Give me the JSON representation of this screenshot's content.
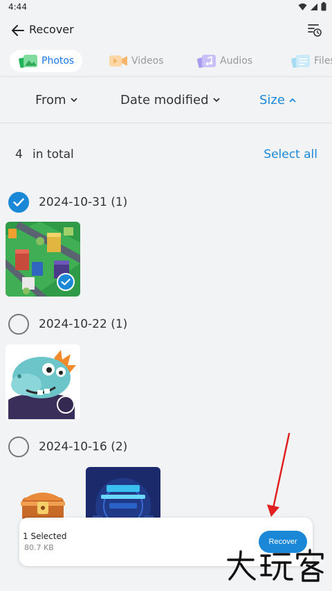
{
  "status_bar": {
    "time": "4:44"
  },
  "header": {
    "title": "Recover"
  },
  "tabs": [
    {
      "label": "Photos",
      "icon": "photo-icon",
      "active": true
    },
    {
      "label": "Videos",
      "icon": "video-icon",
      "active": false
    },
    {
      "label": "Audios",
      "icon": "audio-icon",
      "active": false
    },
    {
      "label": "Files",
      "icon": "file-icon",
      "active": false
    }
  ],
  "sort": {
    "from": "From",
    "date_modified": "Date modified",
    "size": "Size"
  },
  "summary": {
    "count": "4",
    "label": "in total",
    "select_all": "Select all"
  },
  "groups": [
    {
      "date": "2024-10-31 (1)",
      "checked": true
    },
    {
      "date": "2024-10-22 (1)",
      "checked": false
    },
    {
      "date": "2024-10-16 (2)",
      "checked": false
    }
  ],
  "bottom_bar": {
    "selected": "1 Selected",
    "size": "80.7 KB",
    "recover_button": "Recover"
  },
  "watermark": "大玩客",
  "colors": {
    "accent": "#1a88d6",
    "background": "#f2f3f5",
    "annotation": "#e02020"
  }
}
